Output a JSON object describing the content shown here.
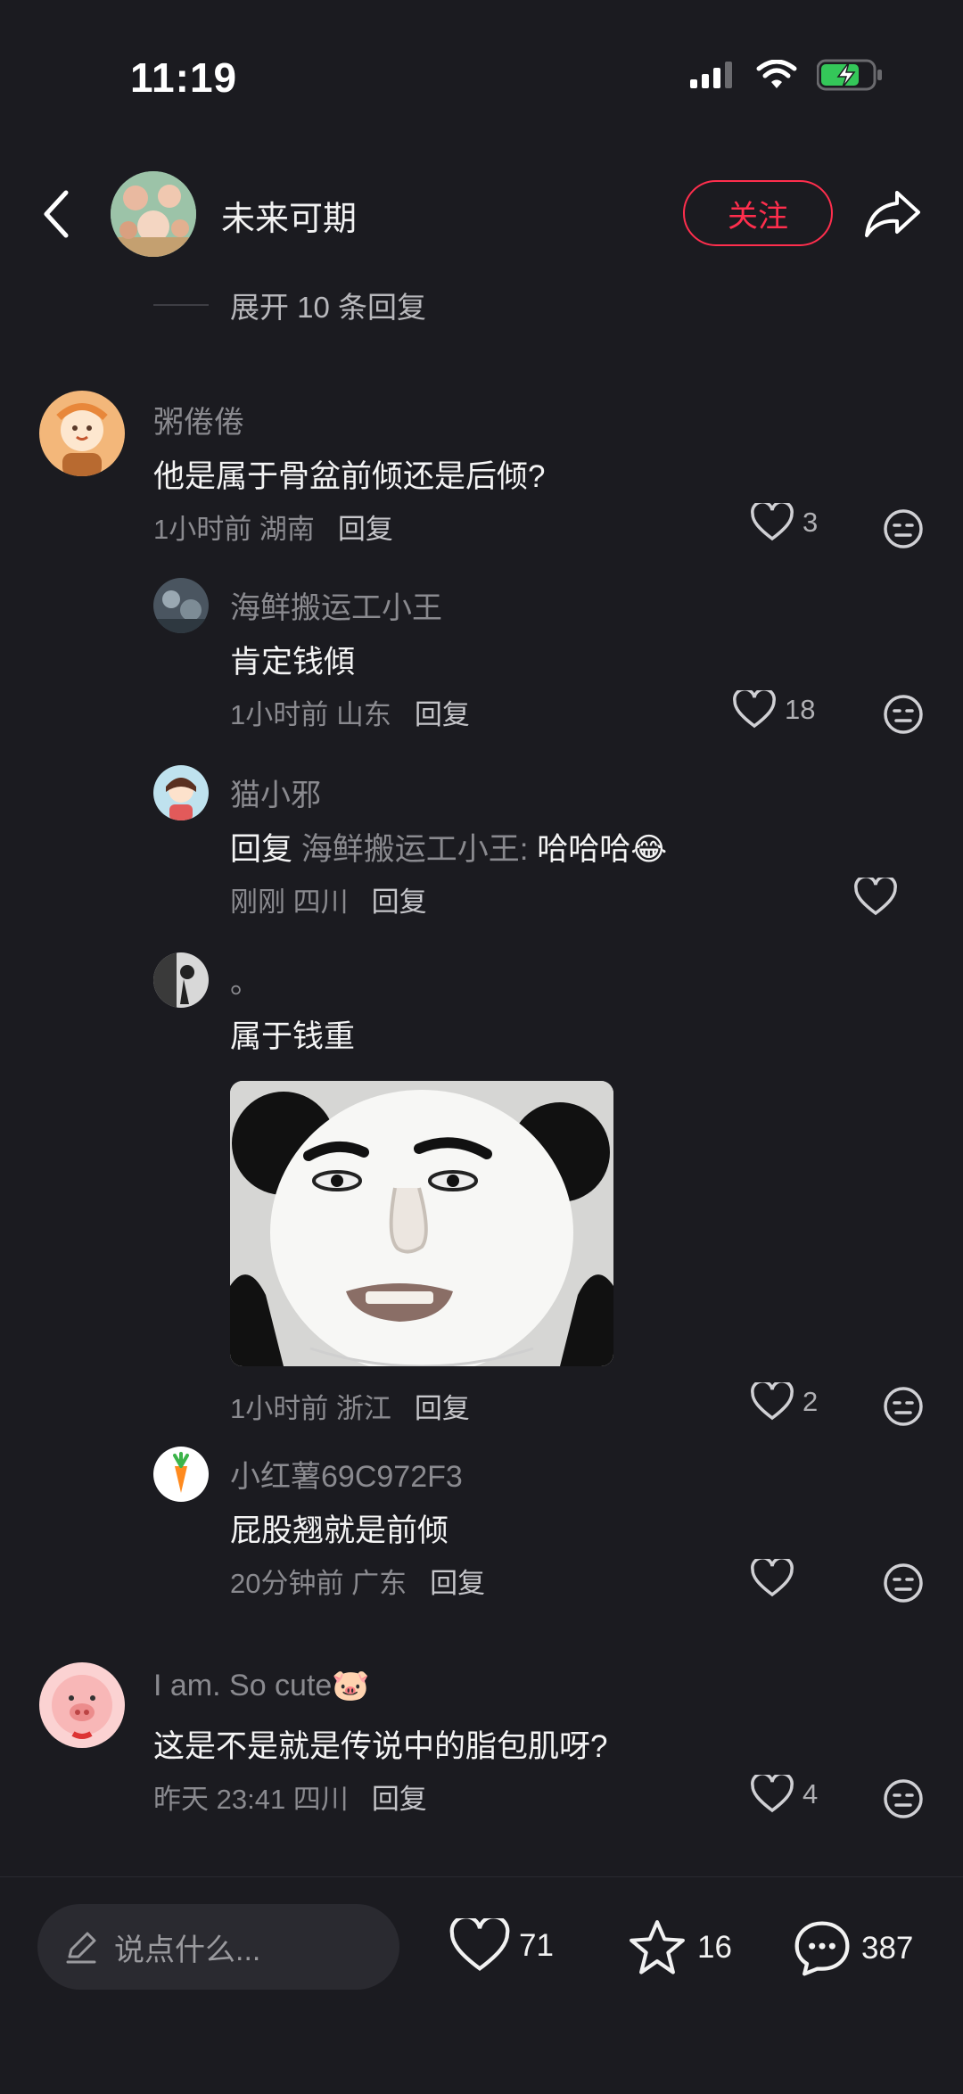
{
  "status": {
    "time": "11:19"
  },
  "header": {
    "author": "未来可期",
    "follow_label": "关注"
  },
  "expand": {
    "label": "展开 10 条回复"
  },
  "comments": [
    {
      "name": "粥倦倦",
      "text": "他是属于骨盆前倾还是后倾?",
      "meta": "1小时前 湖南",
      "reply": "回复",
      "likes": "3"
    },
    {
      "name": "海鲜搬运工小王",
      "text": "肯定钱傾",
      "meta": "1小时前 山东",
      "reply": "回复",
      "likes": "18"
    },
    {
      "name": "猫小邪",
      "reply_prefix": "回复",
      "reply_to": "海鲜搬运工小王:",
      "text": "哈哈哈😂",
      "meta": "刚刚 四川",
      "reply": "回复",
      "likes": ""
    },
    {
      "name": "。",
      "text": "属于钱重",
      "meta": "1小时前 浙江",
      "reply": "回复",
      "likes": "2"
    },
    {
      "name": "小红薯69C972F3",
      "text": "屁股翘就是前倾",
      "meta": "20分钟前 广东",
      "reply": "回复",
      "likes": ""
    },
    {
      "name": "I am. So cute🐷",
      "text": "这是不是就是传说中的脂包肌呀?",
      "meta": "昨天 23:41 四川",
      "reply": "回复",
      "likes": "4"
    }
  ],
  "bottom": {
    "input_placeholder": "说点什么...",
    "likes": "71",
    "stars": "16",
    "comments": "387"
  },
  "colors": {
    "background": "#1b1b20",
    "accent": "#ff2e4d",
    "battery": "#34c759"
  }
}
